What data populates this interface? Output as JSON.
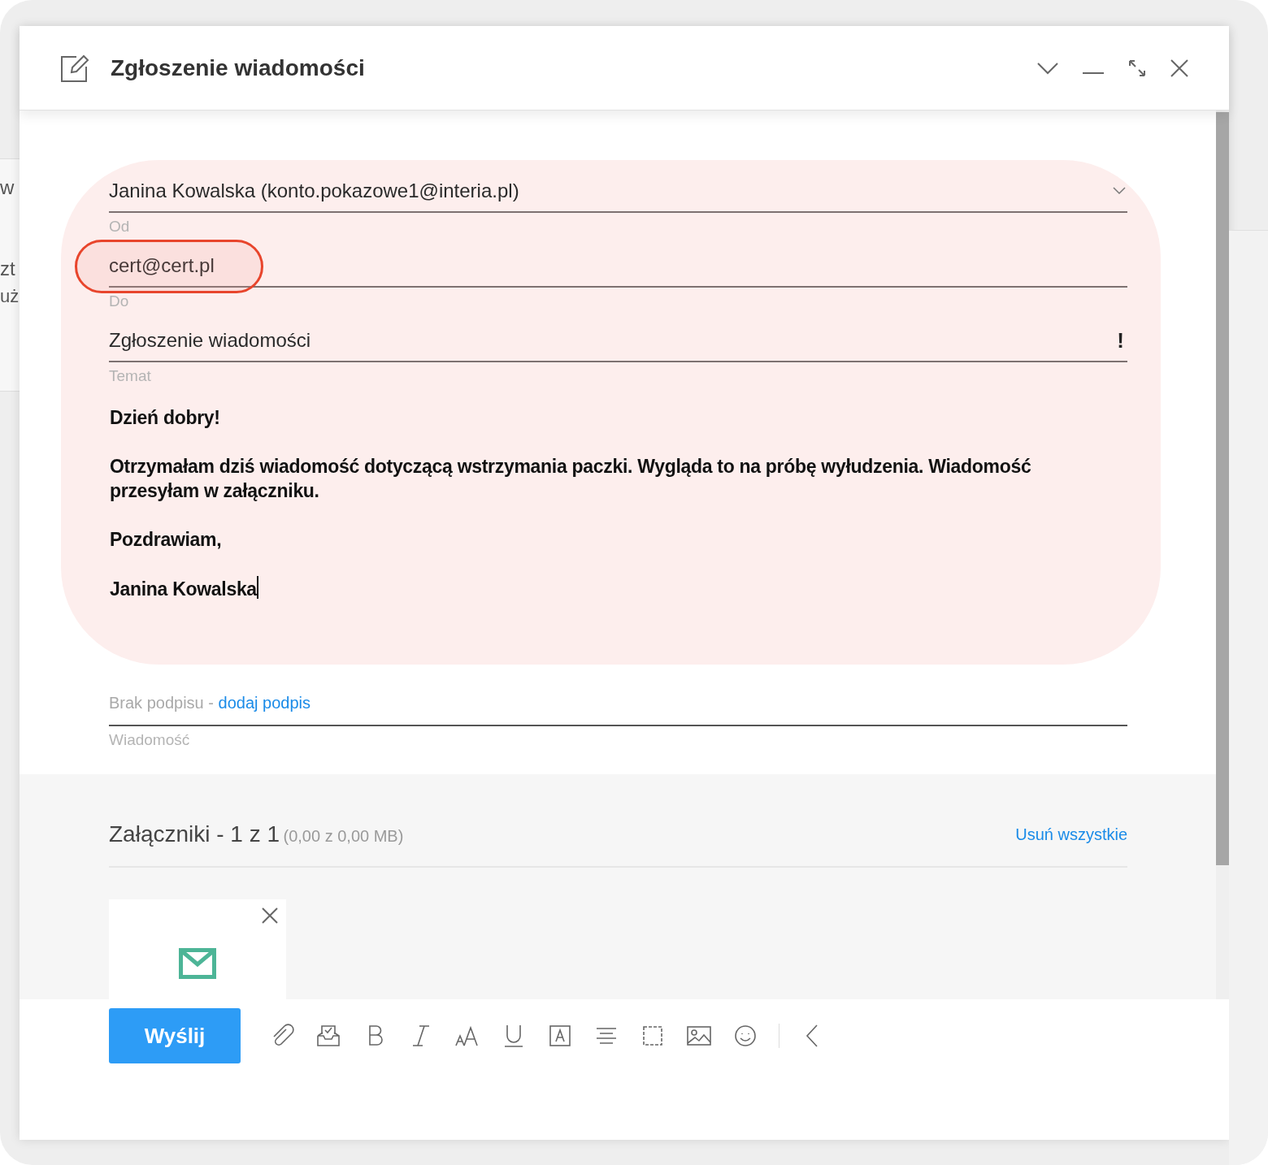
{
  "window": {
    "title": "Zgłoszenie wiadomości"
  },
  "background_fragments": [
    "w",
    "zt",
    "uż"
  ],
  "from": {
    "value": "Janina Kowalska (konto.pokazowe1@interia.pl)",
    "label": "Od"
  },
  "to": {
    "value": "cert@cert.pl",
    "label": "Do",
    "circled": true
  },
  "subject": {
    "value": "Zgłoszenie wiadomości",
    "label": "Temat",
    "priority": "!"
  },
  "body": {
    "highlighted": true,
    "paragraphs": [
      "Dzień dobry!",
      "Otrzymałam dziś wiadomość dotyczącą wstrzymania paczki. Wygląda to na próbę wyłudzenia. Wiadomość przesyłam w załączniku.",
      "Pozdrawiam,",
      "Janina Kowalska"
    ]
  },
  "signature": {
    "text": "Brak podpisu -",
    "link": "dodaj podpis",
    "label": "Wiadomość"
  },
  "attachments": {
    "title": "Załączniki - 1 z 1",
    "size": "(0,00 z 0,00 MB)",
    "remove_all": "Usuń wszystkie",
    "items": [
      {
        "kind": "email"
      }
    ]
  },
  "send_button": "Wyślij",
  "toolbar": [
    {
      "kind": "attach"
    },
    {
      "kind": "inbox"
    },
    {
      "kind": "bold"
    },
    {
      "kind": "italic"
    },
    {
      "kind": "font-size"
    },
    {
      "kind": "underline"
    },
    {
      "kind": "text-color"
    },
    {
      "kind": "align"
    },
    {
      "kind": "frame"
    },
    {
      "kind": "image"
    },
    {
      "kind": "emoji"
    },
    {
      "kind": "separator"
    },
    {
      "kind": "collapse"
    }
  ]
}
